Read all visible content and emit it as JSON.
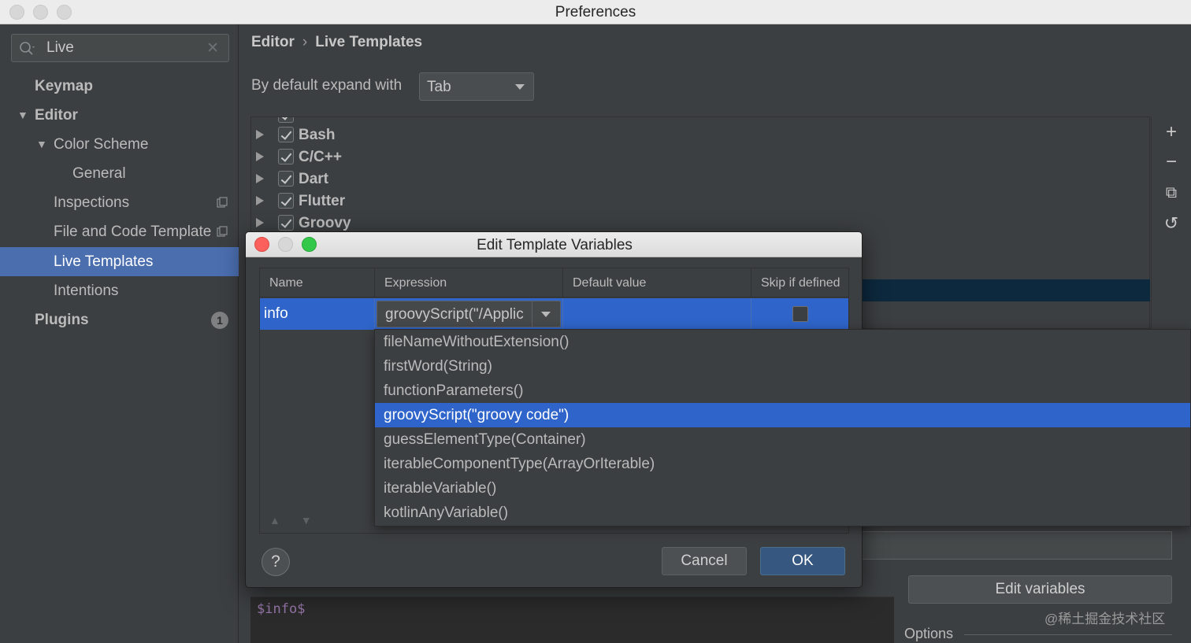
{
  "window": {
    "title": "Preferences"
  },
  "sidebar": {
    "search": {
      "value": "Live"
    },
    "items": [
      {
        "label": "Keymap"
      },
      {
        "label": "Editor"
      },
      {
        "label": "Color Scheme"
      },
      {
        "label": "General"
      },
      {
        "label": "Inspections"
      },
      {
        "label": "File and Code Templates"
      },
      {
        "label": "Live Templates"
      },
      {
        "label": "Intentions"
      },
      {
        "label": "Plugins",
        "badge": "1"
      }
    ]
  },
  "main": {
    "breadcrumb": {
      "parent": "Editor",
      "separator": "›",
      "current": "Live Templates"
    },
    "expand": {
      "label": "By default expand with",
      "value": "Tab"
    },
    "groups": [
      {
        "name": "Bash",
        "checked": true
      },
      {
        "name": "C/C++",
        "checked": true
      },
      {
        "name": "Dart",
        "checked": true
      },
      {
        "name": "Flutter",
        "checked": true
      },
      {
        "name": "Groovy",
        "checked": true
      }
    ],
    "toolbar": {
      "add": "+",
      "remove": "−",
      "copy": "⧉",
      "restore": "↺"
    },
    "edit_variables_label": "Edit variables",
    "code_text": "$info$",
    "options_label": "Options",
    "watermark": "@稀土掘金技术社区"
  },
  "dialog": {
    "title": "Edit Template Variables",
    "columns": [
      "Name",
      "Expression",
      "Default value",
      "Skip if defined"
    ],
    "row": {
      "name": "info",
      "expression": "groovyScript(\"/Applic",
      "default_value": "",
      "skip_if_defined": false
    },
    "cancel_label": "Cancel",
    "ok_label": "OK",
    "help_label": "?"
  },
  "dropdown": {
    "options": [
      "fileNameWithoutExtension()",
      "firstWord(String)",
      "functionParameters()",
      "groovyScript(\"groovy code\")",
      "guessElementType(Container)",
      "iterableComponentType(ArrayOrIterable)",
      "iterableVariable()",
      "kotlinAnyVariable()"
    ],
    "selected_index": 3
  },
  "colors": {
    "selection": "#2f65ca",
    "sidebar_selection": "#4b6eaf",
    "background": "#3c3f41"
  }
}
